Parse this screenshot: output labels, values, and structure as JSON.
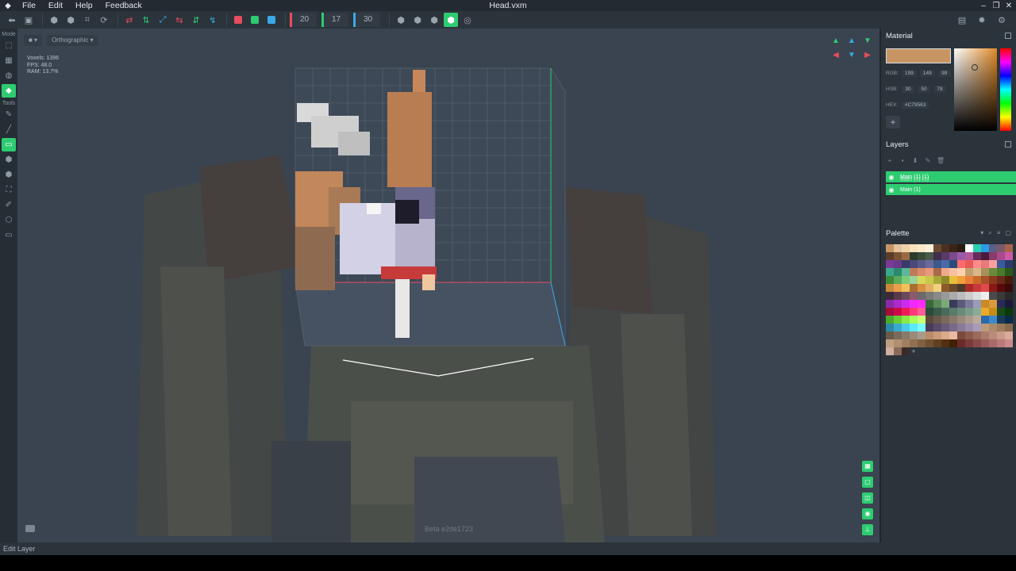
{
  "app": {
    "title": "Head.vxm",
    "menu": [
      "File",
      "Edit",
      "Help",
      "Feedback"
    ]
  },
  "toolbar": {
    "size_x": "20",
    "size_y": "17",
    "size_z": "30",
    "colors": {
      "x": "#e84d5f",
      "y": "#2ecc71",
      "z": "#3aa9e8",
      "accent": "#2ecc71"
    }
  },
  "leftbar": {
    "mode_label": "Mode",
    "tools_label": "Tools"
  },
  "viewport": {
    "projection": "Orthographic",
    "stats": {
      "voxels": "Voxels: 1396",
      "fps": "FPS: 48.0",
      "ram": "RAM: 13.7%"
    },
    "beta": "Beta e2de1723"
  },
  "material": {
    "title": "Material",
    "color": "#c79563",
    "rgb": [
      "199",
      "149",
      "99"
    ],
    "hsb": [
      "30",
      "50",
      "78"
    ],
    "hex": "#C79563",
    "rgb_label": "RGB:",
    "hsb_label": "HSB:",
    "hex_label": "HEX:"
  },
  "layers": {
    "title": "Layers",
    "items": [
      {
        "name": "Main (1) (1)",
        "drag_ghost": "Main (1) (1)"
      },
      {
        "name": "Main (1)"
      }
    ]
  },
  "palette": {
    "title": "Palette",
    "colors": [
      "#c79563",
      "#e4c49b",
      "#f0d2a8",
      "#f7e1bd",
      "#ffe8c8",
      "#fff1d9",
      "#6b4a35",
      "#4a2f22",
      "#3a2418",
      "#2b1b12",
      "#ffffff",
      "#2bd0b0",
      "#2b9be8",
      "#5a5f88",
      "#7a5a6a",
      "#a8624a",
      "#5a3e2a",
      "#7a5233",
      "#9b6a44",
      "#2c3a2a",
      "#3a4a3a",
      "#4a5a4a",
      "#3f2f4a",
      "#5a3a6a",
      "#7a4a8a",
      "#9a5aaa",
      "#b05a9a",
      "#6a2a5a",
      "#4a1a3a",
      "#8a3a6a",
      "#aa4a8a",
      "#cc5aa8",
      "#7a3a9a",
      "#6a3a8a",
      "#3a3a6a",
      "#4a4a7a",
      "#5a5a8a",
      "#6a6a9a",
      "#3a5a8a",
      "#4a6aaa",
      "#2a4a7a",
      "#ff6a6a",
      "#e85a5a",
      "#ff8a8a",
      "#e87a7a",
      "#ffa0a0",
      "#3a5a9a",
      "#2a3a6a",
      "#3aa88a",
      "#2a8a6a",
      "#5ab89a",
      "#c07a5a",
      "#d88a6a",
      "#e89a7a",
      "#a86a4a",
      "#f0aa8a",
      "#f8c0a0",
      "#ffd0b0",
      "#c0a070",
      "#d8b888",
      "#a8905a",
      "#6a8a3a",
      "#4a7a2a",
      "#2a5a1a",
      "#3a8a3a",
      "#5aaa5a",
      "#7aca7a",
      "#9ad49a",
      "#d8d85a",
      "#c8c84a",
      "#a8a83a",
      "#8a8a2a",
      "#e8c03a",
      "#f0a03a",
      "#e8803a",
      "#c86a2a",
      "#a8502a",
      "#8a3a1a",
      "#6a2a1a",
      "#4a1a0a",
      "#c88a3a",
      "#e8a04a",
      "#f0c05a",
      "#a87030",
      "#d89040",
      "#e0b060",
      "#f0d080",
      "#8a5a2a",
      "#6a4a2a",
      "#4a3a2a",
      "#aa2a2a",
      "#c83a3a",
      "#e04a4a",
      "#8a1a1a",
      "#5a0a0a",
      "#3a0a0a",
      "#3a2a3a",
      "#5a3a4a",
      "#6a4a5a",
      "#8a5a6a",
      "#6a6a6a",
      "#7a7a7a",
      "#8a8a8a",
      "#9a9a9a",
      "#aaaaaa",
      "#bbbbbb",
      "#cccccc",
      "#dddddd",
      "#eeeeee",
      "#4a4a4a",
      "#3a3a3a",
      "#2a2a2a",
      "#8a2aaa",
      "#aa2acc",
      "#cc2aee",
      "#ee2aff",
      "#ff2aff",
      "#3a6a3a",
      "#5a8a5a",
      "#7aaa7a",
      "#3a3a5a",
      "#5a5a7a",
      "#7a7a9a",
      "#9a9aba",
      "#ca8a2a",
      "#da9a3a",
      "#2a2a5a",
      "#1a1a3a",
      "#aa0a3a",
      "#cc0a4a",
      "#ee1a5a",
      "#ff3a7a",
      "#ff5a9a",
      "#2a4a3a",
      "#3a5a4a",
      "#4a6a5a",
      "#5a7a6a",
      "#6a8a7a",
      "#7a9a8a",
      "#8aaa9a",
      "#eaaa2a",
      "#ca8a1a",
      "#1a4a1a",
      "#0a3a0a",
      "#4aaa2a",
      "#6aca3a",
      "#8aea4a",
      "#aaff5a",
      "#caff7a",
      "#5a4a3a",
      "#6a5a4a",
      "#7a6a5a",
      "#8a7a6a",
      "#9a8a7a",
      "#aa9a8a",
      "#baa a9a",
      "#2a6aaa",
      "#3a8aca",
      "#1a3a5a",
      "#0a2a4a",
      "#2a8aaa",
      "#3aaaca",
      "#4acaea",
      "#5aeaff",
      "#7affff",
      "#4a3a5a",
      "#5a4a6a",
      "#6a5a7a",
      "#7a6a8a",
      "#8a7a9a",
      "#9a8aaa",
      "#aa9aba",
      "#ba9a7a",
      "#aa8a6a",
      "#9a7a5a",
      "#8a6a4a",
      "#6a5a4a",
      "#7a6a5a",
      "#8a7a6a",
      "#9a8a7a",
      "#aa9a8a",
      "#ba8a6a",
      "#ca9a7a",
      "#daaa8a",
      "#eabaa0",
      "#7a4a3a",
      "#8a5a4a",
      "#9a6a5a",
      "#aa7a6a",
      "#ba8a7a",
      "#ca9a8a",
      "#daaa9a",
      "#c0a080",
      "#b09070",
      "#a08060",
      "#907050",
      "#806040",
      "#705030",
      "#604020",
      "#503010",
      "#402000",
      "#6a2a2a",
      "#7a3a3a",
      "#8a4a4a",
      "#9a5a5a",
      "#aa6a6a",
      "#ba7a7a",
      "#ca8a8a",
      "#d0b0a0",
      "#8a6a5a",
      "#3a2a2a"
    ]
  },
  "status": {
    "text": "Edit Layer"
  }
}
